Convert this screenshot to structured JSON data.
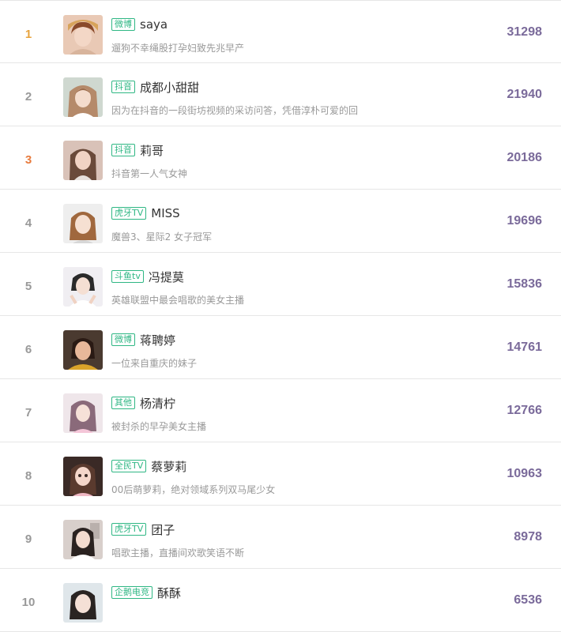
{
  "colors": {
    "rank_gold": "#e8a33d",
    "rank_silver": "#9a9a9a",
    "rank_bronze": "#e87b3d",
    "rank_default": "#999999",
    "tag_green": "#2fb784",
    "score_purple": "#7a6a9a"
  },
  "rows": [
    {
      "rank": "1",
      "tag": "微博",
      "name": "saya",
      "desc": "遛狗不幸绳股打孕妇致先兆早产",
      "score": "31298",
      "avatar_icon": "avatar-photo"
    },
    {
      "rank": "2",
      "tag": "抖音",
      "name": "成都小甜甜",
      "desc": "因为在抖音的一段街坊视频的采访问答，凭借淳朴可爱的回",
      "score": "21940",
      "avatar_icon": "avatar-photo"
    },
    {
      "rank": "3",
      "tag": "抖音",
      "name": "莉哥",
      "desc": "抖音第一人气女神",
      "score": "20186",
      "avatar_icon": "avatar-photo"
    },
    {
      "rank": "4",
      "tag": "虎牙TV",
      "name": "MISS",
      "desc": "魔兽3、星际2 女子冠军",
      "score": "19696",
      "avatar_icon": "avatar-photo"
    },
    {
      "rank": "5",
      "tag": "斗鱼tv",
      "name": "冯提莫",
      "desc": "英雄联盟中最会唱歌的美女主播",
      "score": "15836",
      "avatar_icon": "avatar-photo"
    },
    {
      "rank": "6",
      "tag": "微博",
      "name": "蒋聘婷",
      "desc": "一位来自重庆的妹子",
      "score": "14761",
      "avatar_icon": "avatar-photo"
    },
    {
      "rank": "7",
      "tag": "其他",
      "name": "杨清柠",
      "desc": "被封杀的早孕美女主播",
      "score": "12766",
      "avatar_icon": "avatar-photo"
    },
    {
      "rank": "8",
      "tag": "全民TV",
      "name": "蔡萝莉",
      "desc": "00后萌萝莉，绝对领域系列双马尾少女",
      "score": "10963",
      "avatar_icon": "avatar-photo"
    },
    {
      "rank": "9",
      "tag": "虎牙TV",
      "name": "团子",
      "desc": "唱歌主播，直播间欢歌笑语不断",
      "score": "8978",
      "avatar_icon": "avatar-photo"
    },
    {
      "rank": "10",
      "tag": "企鹅电竞",
      "name": "酥酥",
      "desc": "",
      "score": "6536",
      "avatar_icon": "avatar-photo"
    }
  ]
}
